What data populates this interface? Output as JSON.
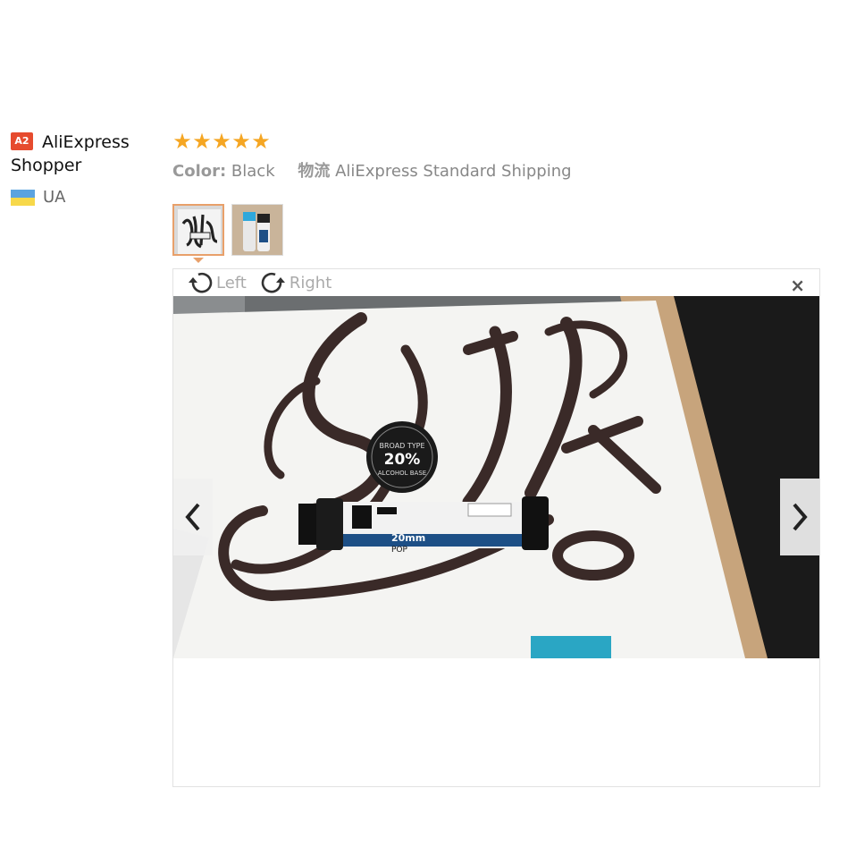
{
  "reviewer": {
    "badge": "A2",
    "name_line1": "AliExpress",
    "name_line2": "Shopper",
    "country": "UA"
  },
  "review": {
    "rating": 5,
    "stars": "★★★★★",
    "color_label": "Color:",
    "color_value": "Black",
    "shipping_label": "物流",
    "shipping_value": "AliExpress Standard Shipping"
  },
  "thumbnails": [
    {
      "icon": "calligraphy-photo",
      "selected": true
    },
    {
      "icon": "markers-photo",
      "selected": false
    }
  ],
  "viewer": {
    "rotate_left": "Left",
    "rotate_right": "Right",
    "close": "×",
    "photo_text": {
      "cap_top": "BROAD TYPE",
      "cap_pct": "20%",
      "cap_bottom": "ALCOHOL BASE",
      "marker_size": "20mm",
      "marker_brand": "POP"
    }
  },
  "colors": {
    "star": "#f5a623",
    "badge": "#e64b2e",
    "thumb_border_active": "#e8a06a"
  }
}
